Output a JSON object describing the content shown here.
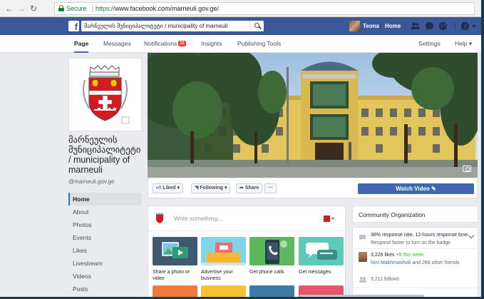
{
  "browser": {
    "secure_label": "Secure",
    "url_scheme": "https://",
    "url_rest": "www.facebook.com/marneuli.gov.ge/"
  },
  "fb_header": {
    "search_value": "მარნეულის მუნიციპალიტეტი / municipality of marneuli",
    "user_name": "Teona",
    "home_label": "Home"
  },
  "page_nav": {
    "tabs": [
      {
        "label": "Page",
        "active": true
      },
      {
        "label": "Messages"
      },
      {
        "label": "Notifications",
        "badge": "11"
      },
      {
        "label": "Insights"
      },
      {
        "label": "Publishing Tools"
      }
    ],
    "settings_label": "Settings",
    "help_label": "Help ▾"
  },
  "page": {
    "name_lines": [
      "მარნეულის",
      "მუნიციპალიტეტი",
      "/ municipality of",
      "marneuli"
    ],
    "username": "@marneuli.gov.ge"
  },
  "left_nav": [
    "Home",
    "About",
    "Photos",
    "Events",
    "Likes",
    "Livestream",
    "Videos",
    "Posts"
  ],
  "actions": {
    "liked": "Liked ▾",
    "following": "Following ▾",
    "share": "Share",
    "more": "···",
    "watch_video": "Watch Video ✎"
  },
  "composer": {
    "placeholder": "Write something...",
    "tiles": [
      {
        "label": "Share a photo or video"
      },
      {
        "label": "Advertise your business"
      },
      {
        "label": "Get phone calls"
      },
      {
        "label": "Get messages"
      }
    ]
  },
  "right": {
    "community_title": "Community Organization",
    "response_rate": "38% response rate, 12-hours response time",
    "respond_faster": "Respond faster to turn on the badge",
    "likes_count": "3,226 likes",
    "likes_delta": "+6 this week",
    "friends_name": "Nini Makhmashvili",
    "friends_rest": " and 266 other friends",
    "follows": "3,211 follows"
  },
  "colors": {
    "fb_blue": "#3b5998",
    "button_blue": "#4267b2",
    "notification_red": "#fa3e3e",
    "secure_green": "#188038"
  }
}
